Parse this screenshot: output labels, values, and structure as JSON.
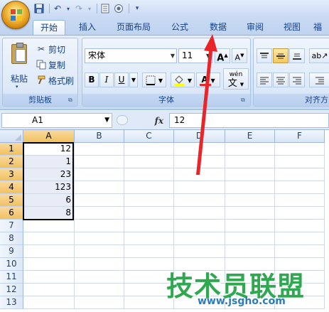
{
  "quick_access": {
    "icons": [
      "save-icon",
      "undo-icon",
      "redo-icon",
      "print-preview-icon",
      "record-icon",
      "customize-icon"
    ]
  },
  "ribbon_tabs": [
    "开始",
    "插入",
    "页面布局",
    "公式",
    "数据",
    "审阅",
    "视图",
    "福"
  ],
  "active_tab": "开始",
  "clipboard": {
    "paste_label": "粘贴",
    "cut_label": "剪切",
    "copy_label": "复制",
    "format_painter_label": "格式刷",
    "group_label": "剪贴板"
  },
  "font": {
    "font_name": "宋体",
    "font_size": "11",
    "grow_label": "A",
    "shrink_label": "A",
    "bold_label": "B",
    "italic_label": "I",
    "underline_label": "U",
    "wen_label": "wén",
    "wen_char": "文",
    "group_label": "字体"
  },
  "alignment": {
    "group_label": "对齐方"
  },
  "formula_bar": {
    "name_box": "A1",
    "fx_label": "fx",
    "formula_value": "12"
  },
  "sheet": {
    "columns": [
      "A",
      "B",
      "C",
      "D",
      "E",
      "F"
    ],
    "rows": [
      "1",
      "2",
      "3",
      "4",
      "5",
      "6",
      "7",
      "8",
      "9",
      "10",
      "11",
      "12",
      "13"
    ],
    "column_a_values": [
      "12",
      "1",
      "23",
      "123",
      "6",
      "8",
      "",
      "",
      "",
      "",
      "",
      "",
      ""
    ]
  },
  "watermark": {
    "title": "技术员联盟",
    "url": "www.jsgho.com"
  },
  "colors": {
    "annotation_arrow": "#e8262a",
    "watermark_green": "#2fa84f",
    "watermark_blue": "#2a7db8"
  }
}
